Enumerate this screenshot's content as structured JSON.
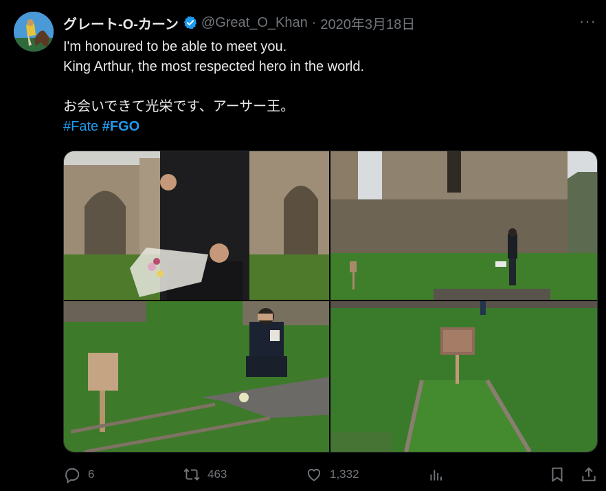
{
  "tweet": {
    "author_name": "グレート-O-カーン",
    "handle": "@Great_O_Khan",
    "separator": "·",
    "date": "2020年3月18日",
    "more_label": "···",
    "lines": [
      "I'm honoured to be able to meet you.",
      "King Arthur, the most respected hero in the world.",
      "",
      "お会いできて光栄です、アーサー王。"
    ],
    "hashtags": [
      "#Fate",
      "#FGO"
    ]
  },
  "actions": {
    "reply_count": "6",
    "retweet_count": "463",
    "like_count": "1,332"
  },
  "colors": {
    "background": "#000000",
    "text": "#e7e9ea",
    "muted": "#71767b",
    "link": "#1d9bf0",
    "verified": "#1d9bf0"
  },
  "icons": {
    "verified": "verified-badge-icon",
    "reply": "reply-icon",
    "retweet": "retweet-icon",
    "like": "heart-icon",
    "views": "analytics-icon",
    "bookmark": "bookmark-icon",
    "share": "share-icon"
  }
}
